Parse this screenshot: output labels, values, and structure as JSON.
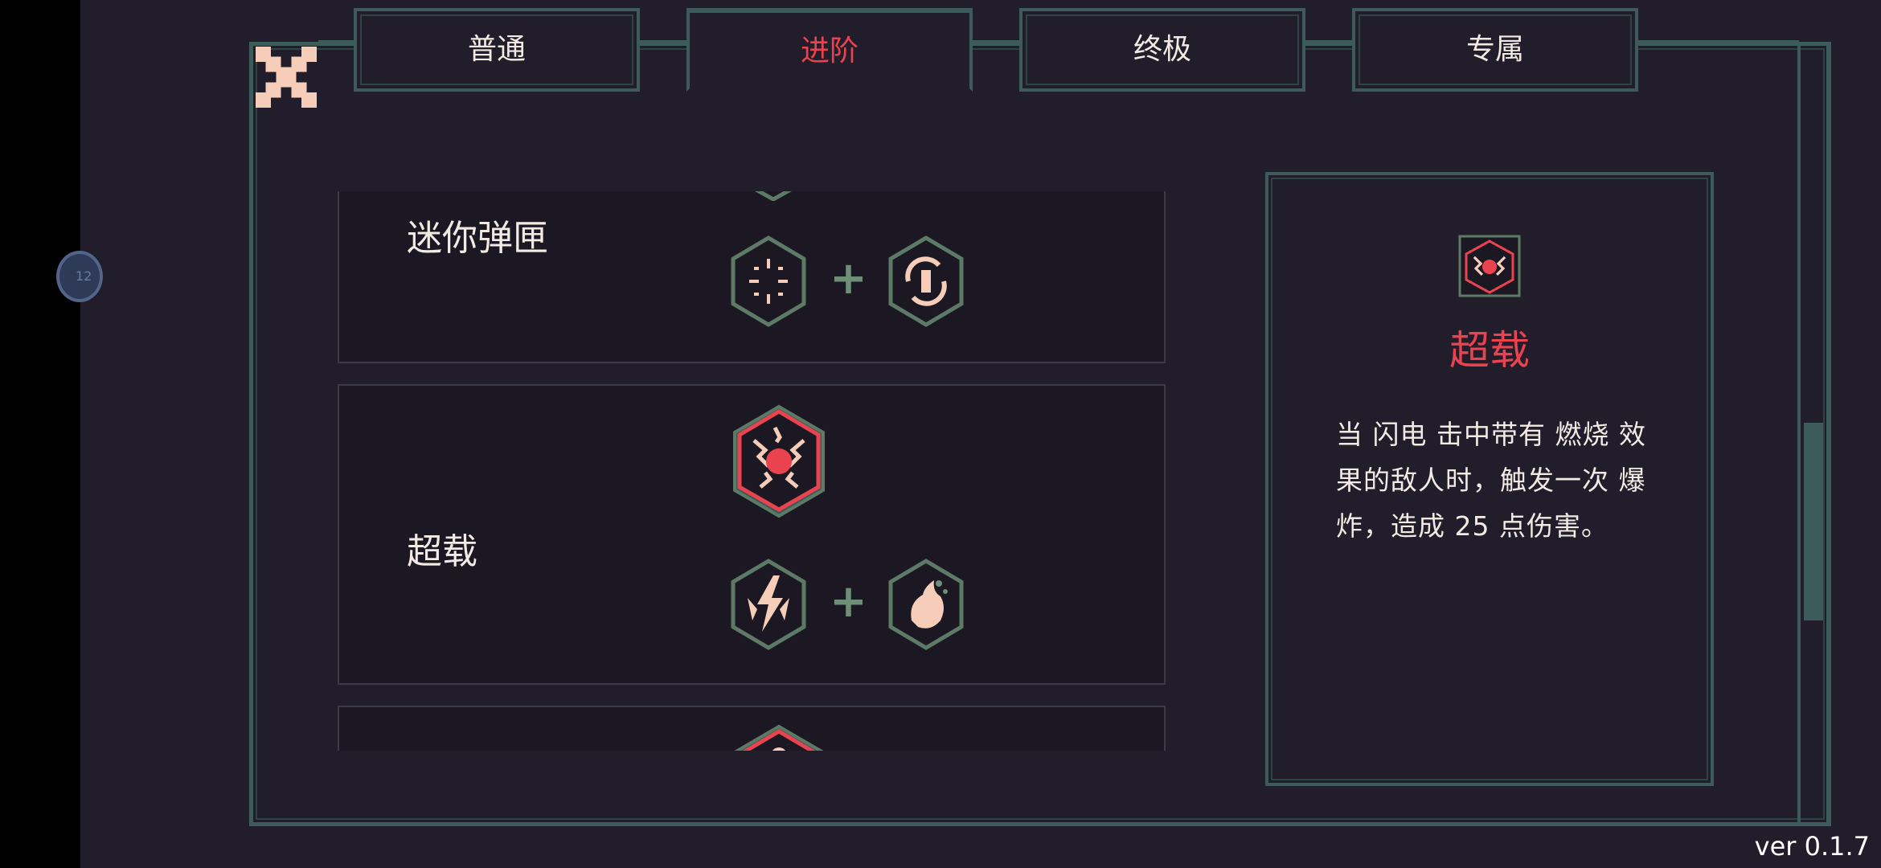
{
  "tabs": [
    {
      "label": "普通",
      "active": false
    },
    {
      "label": "进阶",
      "active": true
    },
    {
      "label": "终极",
      "active": false
    },
    {
      "label": "专属",
      "active": false
    }
  ],
  "side_bubble": {
    "text": "12"
  },
  "recipes": [
    {
      "name": "迷你弹匣",
      "result_icon": "mini-magazine-icon",
      "ingredients": [
        "spread-shot-icon",
        "reload-cycle-icon"
      ]
    },
    {
      "name": "超载",
      "result_icon": "overload-icon",
      "ingredients": [
        "lightning-icon",
        "fire-icon"
      ]
    },
    {
      "name": "",
      "result_icon": "next-recipe-icon",
      "ingredients": []
    }
  ],
  "detail": {
    "icon": "overload-icon",
    "title": "超载",
    "description": "当 闪电 击中带有 燃烧 效果的敌人时，触发一次 爆炸，造成 25 点伤害。"
  },
  "version": "ver 0.1.7",
  "colors": {
    "accent": "#e9434f",
    "frame": "#3d5b5a",
    "background": "#221d2b",
    "text": "#f2ebe4"
  }
}
